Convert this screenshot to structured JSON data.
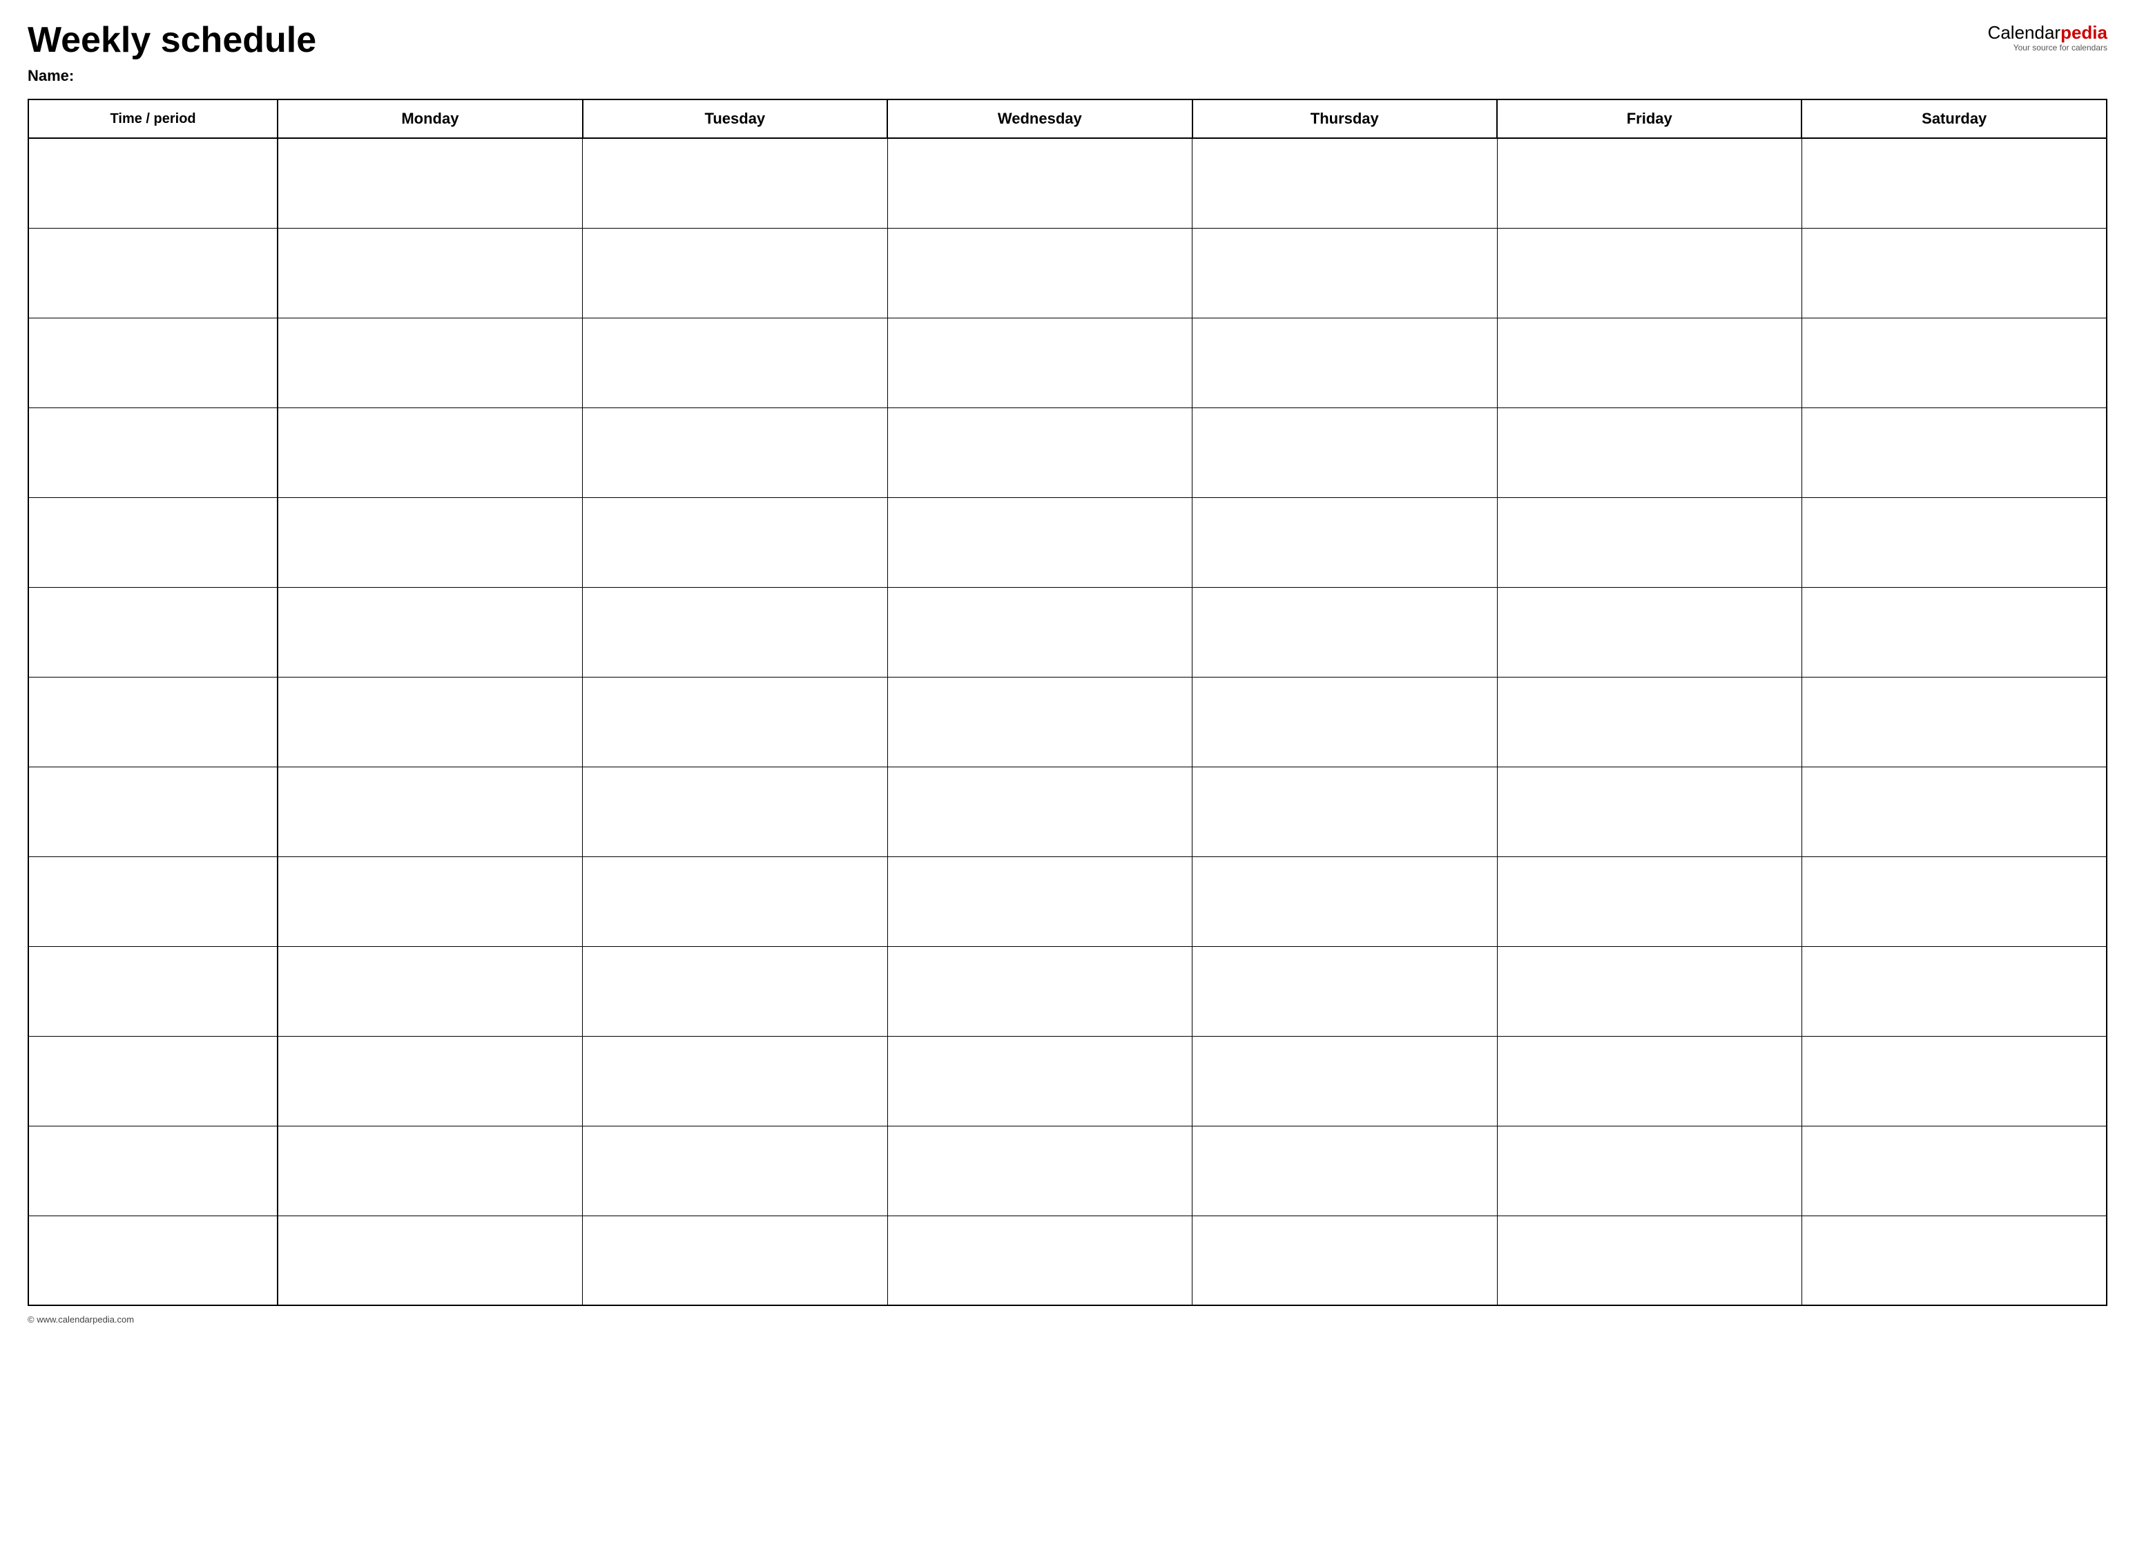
{
  "header": {
    "title": "Weekly schedule",
    "name_label": "Name:",
    "logo": {
      "calendar": "Calendar",
      "pedia": "pedia",
      "tagline": "Your source for calendars"
    }
  },
  "table": {
    "columns": [
      {
        "key": "time",
        "label": "Time / period"
      },
      {
        "key": "monday",
        "label": "Monday"
      },
      {
        "key": "tuesday",
        "label": "Tuesday"
      },
      {
        "key": "wednesday",
        "label": "Wednesday"
      },
      {
        "key": "thursday",
        "label": "Thursday"
      },
      {
        "key": "friday",
        "label": "Friday"
      },
      {
        "key": "saturday",
        "label": "Saturday"
      }
    ],
    "row_count": 13
  },
  "footer": {
    "copyright": "© www.calendarpedia.com"
  }
}
